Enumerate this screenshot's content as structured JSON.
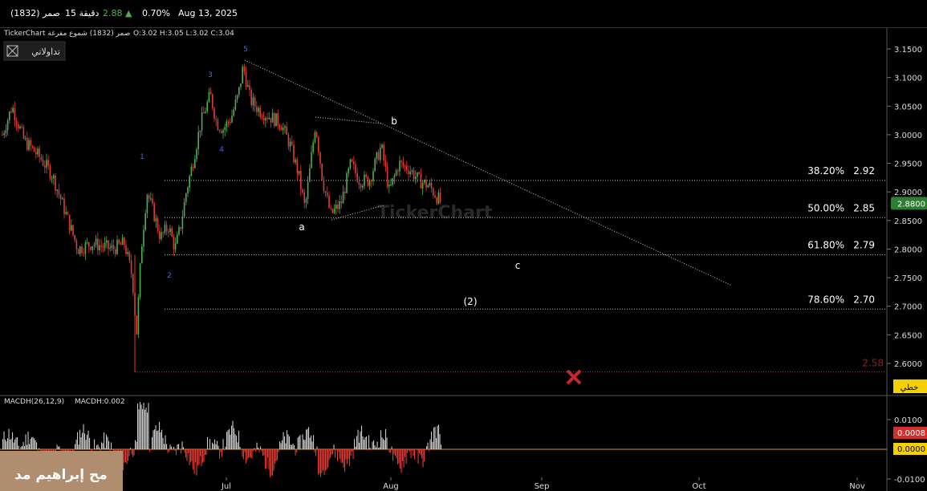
{
  "header": {
    "symbol": "صمر (1832)",
    "interval": "15 دقيقة",
    "price": "2.88",
    "change_arrow": "▲",
    "change_pct": "0.70%",
    "date": "Aug 13, 2025"
  },
  "chart_header": {
    "info": "TickerChart صمر (1832) شموع مفرغة",
    "ohlc": "O:3.02  H:3.05  L:3.02  C:3.04",
    "brand_button": "تداولاتي",
    "watermark": "TickerChart"
  },
  "overlay_label": "مح إبراهيم مد",
  "chart_data": [
    {
      "type": "candlestick",
      "x_axis": {
        "tick_labels": [
          "Jul",
          "Aug",
          "Sep",
          "Oct",
          "Nov"
        ]
      },
      "y_axis": {
        "range": [
          2.575,
          3.175
        ],
        "tick_labels": [
          "3.1500",
          "3.1000",
          "3.0500",
          "3.0000",
          "2.9500",
          "2.9000",
          "2.8500",
          "2.8000",
          "2.7500",
          "2.7000",
          "2.6500",
          "2.6000"
        ],
        "tick_values": [
          3.15,
          3.1,
          3.05,
          3.0,
          2.95,
          2.9,
          2.85,
          2.8,
          2.75,
          2.7,
          2.65,
          2.6
        ]
      },
      "last_price_label": "2.8800",
      "last_price": 2.88,
      "fibonacci_levels": [
        {
          "pct": "38.20%",
          "value": "2.92",
          "price": 2.92
        },
        {
          "pct": "50.00%",
          "value": "2.85",
          "price": 2.855
        },
        {
          "pct": "61.80%",
          "value": "2.79",
          "price": 2.79
        },
        {
          "pct": "78.60%",
          "value": "2.70",
          "price": 2.695
        }
      ],
      "stop_level": {
        "label": "2.58",
        "price": 2.585,
        "tag": "خطي"
      },
      "wave_labels": [
        {
          "text": "1",
          "color": "#3b6cff"
        },
        {
          "text": "2",
          "color": "#3b6cff"
        },
        {
          "text": "3",
          "color": "#3b6cff"
        },
        {
          "text": "4",
          "color": "#3b6cff"
        },
        {
          "text": "5",
          "color": "#3b6cff"
        },
        {
          "text": "a",
          "color": "#ffffff"
        },
        {
          "text": "b",
          "color": "#ffffff"
        },
        {
          "text": "c",
          "color": "#ffffff"
        },
        {
          "text": "(2)",
          "color": "#ffffff"
        }
      ],
      "colors": {
        "up": "#4caf50",
        "down": "#e53935"
      }
    },
    {
      "type": "bar",
      "title": "MACDH(26,12,9)",
      "value_label": "MACDH:0.002",
      "y_axis": {
        "tick_labels": [
          "0.0100",
          "-0.0100"
        ],
        "tick_values": [
          0.01,
          -0.01
        ],
        "range": [
          -0.013,
          0.0155
        ]
      },
      "current_value": "0.0008",
      "zero_label": "0.0000",
      "colors": {
        "positive": "#c8c8c8",
        "negative": "#e53935",
        "zero_line": "#d4a017"
      }
    }
  ]
}
